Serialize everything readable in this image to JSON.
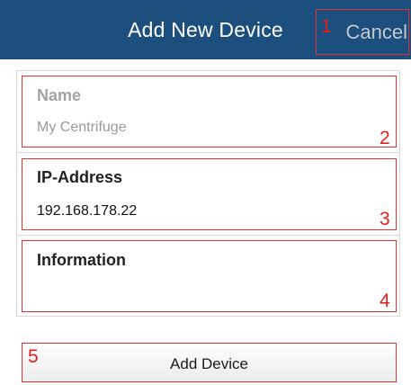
{
  "header": {
    "title": "Add New Device",
    "cancel_label": "Cancel"
  },
  "form": {
    "name": {
      "label": "Name",
      "placeholder": "My Centrifuge",
      "value": ""
    },
    "ip": {
      "label": "IP-Address",
      "value": "192.168.178.22"
    },
    "info": {
      "label": "Information",
      "value": ""
    }
  },
  "actions": {
    "add_label": "Add Device"
  },
  "annotations": [
    "1",
    "2",
    "3",
    "4",
    "5"
  ],
  "colors": {
    "header_bg": "#1d4f7e",
    "annotation": "#e41e1e",
    "muted_text": "#9a9a9a"
  }
}
